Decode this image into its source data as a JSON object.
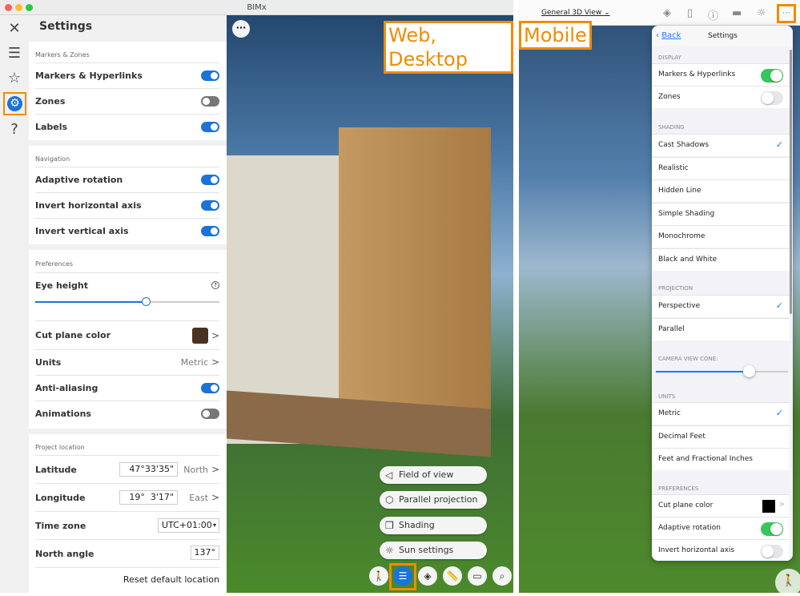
{
  "window": {
    "title": "BIMx"
  },
  "rail": {
    "items": [
      "close",
      "list",
      "favorites",
      "settings",
      "help"
    ]
  },
  "settings": {
    "title": "Settings",
    "markers": {
      "header": "Markers & Zones",
      "rows": [
        {
          "label": "Markers & Hyperlinks",
          "on": true
        },
        {
          "label": "Zones",
          "on": false
        },
        {
          "label": "Labels",
          "on": true
        }
      ]
    },
    "navigation": {
      "header": "Navigation",
      "rows": [
        {
          "label": "Adaptive rotation",
          "on": true
        },
        {
          "label": "Invert horizontal axis",
          "on": true
        },
        {
          "label": "Invert vertical axis",
          "on": true
        }
      ]
    },
    "preferences": {
      "header": "Preferences",
      "eye_height": "Eye height",
      "eye_height_value": 0.6,
      "help": "?",
      "cut_plane_color": "Cut plane color",
      "cut_plane_color_value": "#4a3222",
      "units": "Units",
      "units_value": "Metric",
      "anti_aliasing": "Anti-aliasing",
      "anti_aliasing_on": true,
      "animations": "Animations",
      "animations_on": false
    },
    "location": {
      "header": "Project location",
      "latitude": "Latitude",
      "latitude_value": "47°33'35\"",
      "latitude_dir": "North",
      "longitude": "Longitude",
      "longitude_value": "19°  3'17\"",
      "longitude_dir": "East",
      "timezone": "Time zone",
      "timezone_value": "UTC+01:00",
      "north_angle": "North angle",
      "north_angle_value": "137°",
      "reset": "Reset default location"
    }
  },
  "viewport": {
    "more": "···",
    "menu": [
      "Field of view",
      "Parallel projection",
      "Shading",
      "Sun settings"
    ]
  },
  "labels": {
    "web": "Web, Desktop",
    "mobile": "Mobile"
  },
  "mobile": {
    "view_name": "General 3D View",
    "back": "Back",
    "title": "Settings",
    "display": {
      "header": "DISPLAY",
      "rows": [
        {
          "label": "Markers & Hyperlinks",
          "on": true
        },
        {
          "label": "Zones",
          "on": false
        }
      ]
    },
    "shading": {
      "header": "SHADING",
      "rows": [
        "Cast Shadows",
        "Realistic",
        "Hidden Line",
        "Simple Shading",
        "Monochrome",
        "Black and White"
      ],
      "selected": 0
    },
    "projection": {
      "header": "PROJECTION",
      "rows": [
        "Perspective",
        "Parallel"
      ],
      "selected": 0
    },
    "camera": {
      "header": "CAMERA VIEW CONE:",
      "value": 0.7
    },
    "units": {
      "header": "UNITS",
      "rows": [
        "Metric",
        "Decimal Feet",
        "Feet and Fractional Inches"
      ],
      "selected": 0
    },
    "preferences": {
      "header": "PREFERENCES",
      "cut_plane": "Cut plane color",
      "adaptive": "Adaptive rotation",
      "adaptive_on": true,
      "invert": "Invert horizontal axis",
      "invert_on": false
    }
  },
  "colors": {
    "accent": "#1a73d9",
    "highlight": "#f08c00",
    "ios_green": "#34c759"
  }
}
